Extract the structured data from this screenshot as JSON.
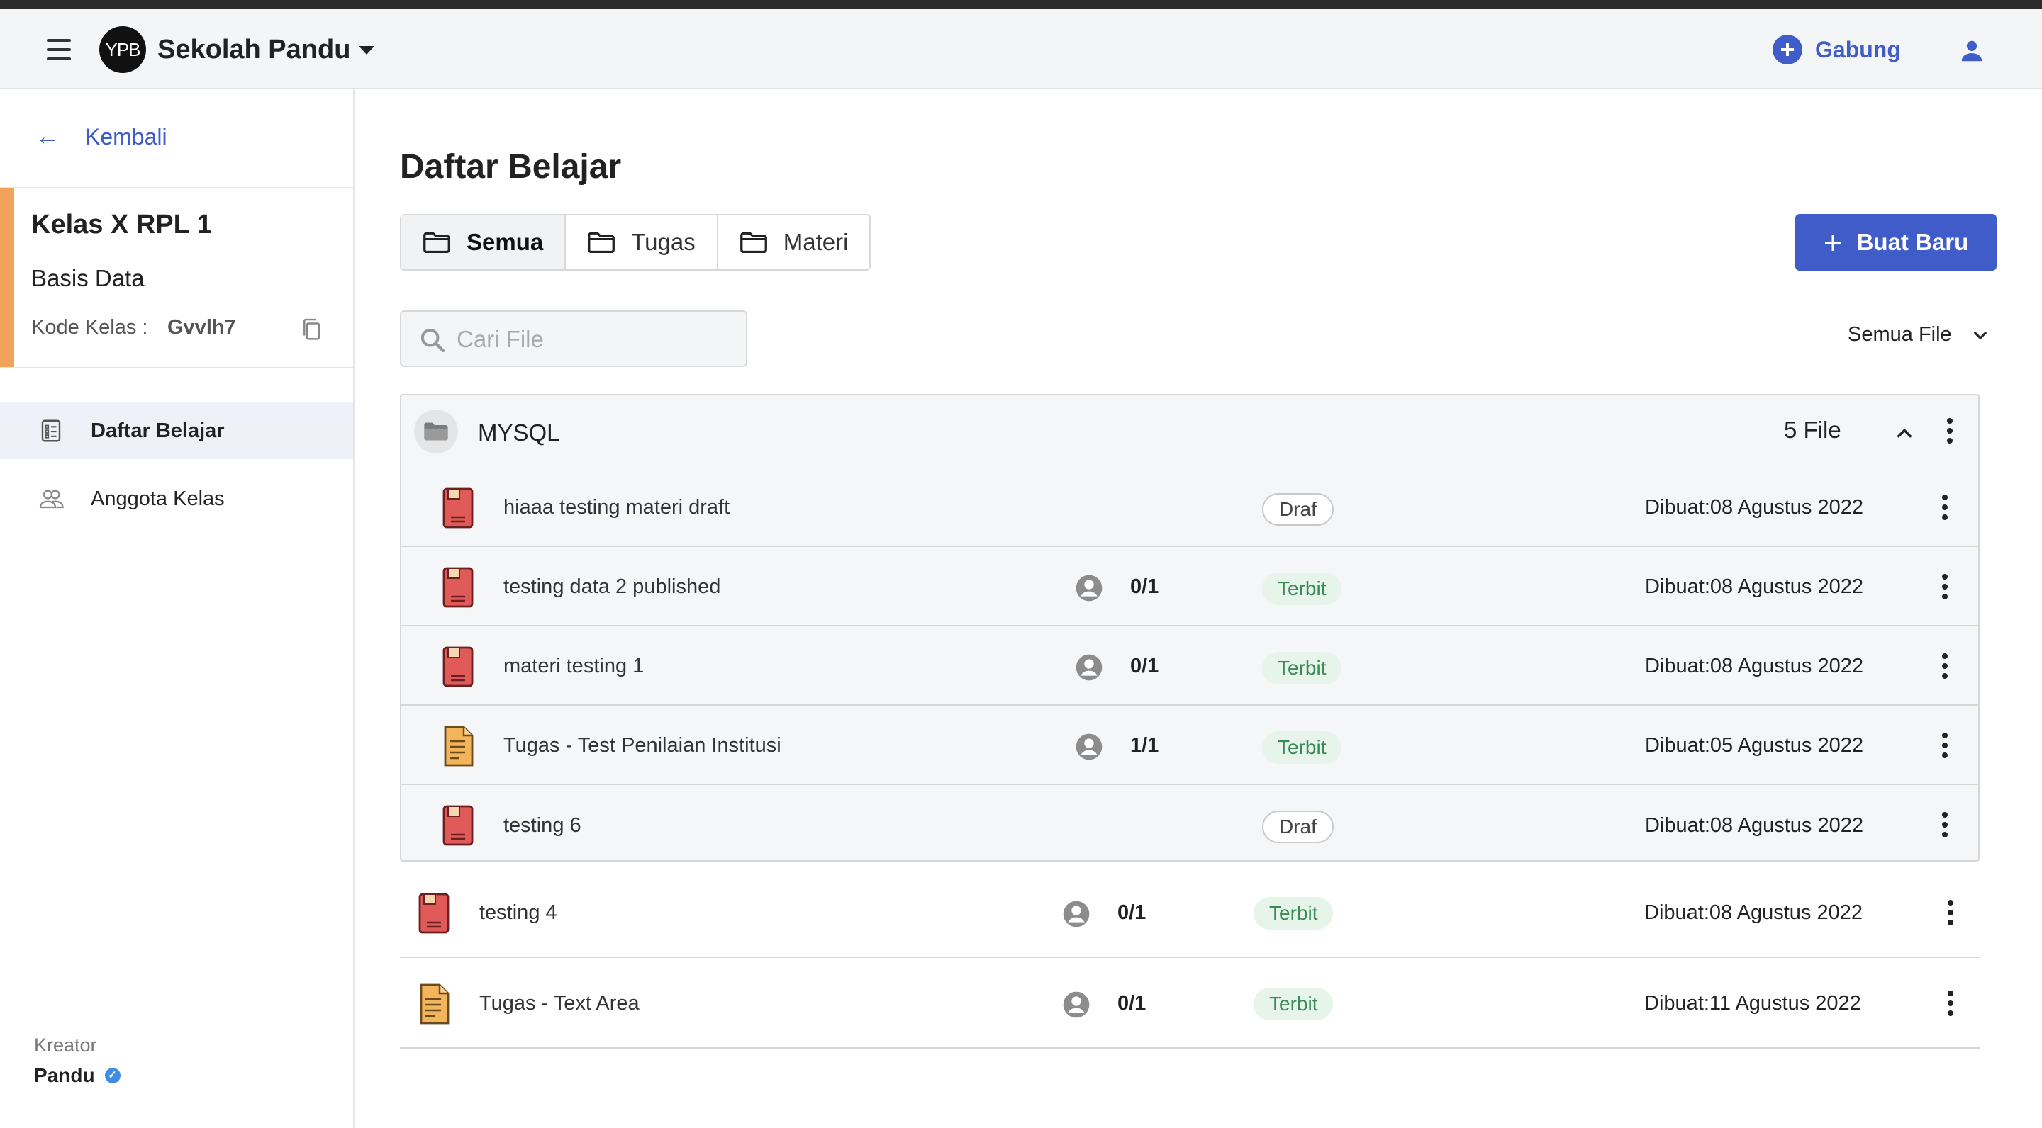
{
  "app": {
    "logo_text": "YPB",
    "title": "Sekolah Pandu",
    "join_label": "Gabung"
  },
  "sidebar": {
    "back_label": "Kembali",
    "class_name": "Kelas X RPL 1",
    "subject": "Basis Data",
    "code_label": "Kode Kelas :",
    "code_value": "Gvvlh7",
    "nav": [
      {
        "label": "Daftar Belajar",
        "icon": "document-list-icon",
        "active": true
      },
      {
        "label": "Anggota Kelas",
        "icon": "people-icon",
        "active": false
      }
    ],
    "creator_label": "Kreator",
    "creator_name": "Pandu"
  },
  "main": {
    "title": "Daftar Belajar",
    "tabs": [
      {
        "label": "Semua",
        "active": true
      },
      {
        "label": "Tugas",
        "active": false
      },
      {
        "label": "Materi",
        "active": false
      }
    ],
    "create_label": "Buat Baru",
    "search_placeholder": "Cari File",
    "filter_label": "Semua File",
    "group": {
      "name": "MYSQL",
      "count_label": "5 File",
      "items": [
        {
          "title": "hiaaa testing materi draft",
          "type": "materi",
          "progress": "",
          "status": "Draf",
          "date": "Dibuat:08 Agustus 2022"
        },
        {
          "title": "testing data 2 published",
          "type": "materi",
          "progress": "0/1",
          "status": "Terbit",
          "date": "Dibuat:08 Agustus 2022"
        },
        {
          "title": "materi testing 1",
          "type": "materi",
          "progress": "0/1",
          "status": "Terbit",
          "date": "Dibuat:08 Agustus 2022"
        },
        {
          "title": "Tugas - Test Penilaian Institusi",
          "type": "tugas",
          "progress": "1/1",
          "status": "Terbit",
          "date": "Dibuat:05 Agustus 2022"
        },
        {
          "title": "testing 6",
          "type": "materi",
          "progress": "",
          "status": "Draf",
          "date": "Dibuat:08 Agustus 2022"
        }
      ]
    },
    "items": [
      {
        "title": "testing 4",
        "type": "materi",
        "progress": "0/1",
        "status": "Terbit",
        "date": "Dibuat:08 Agustus 2022"
      },
      {
        "title": "Tugas - Text Area",
        "type": "tugas",
        "progress": "0/1",
        "status": "Terbit",
        "date": "Dibuat:11 Agustus 2022"
      }
    ]
  },
  "colors": {
    "primary": "#3f5cc8",
    "accent": "#f0a35a",
    "terbit_bg": "#e6f4ea",
    "terbit_text": "#3a8a57",
    "materi_icon": "#e05a5a",
    "tugas_icon": "#f3b45a"
  }
}
